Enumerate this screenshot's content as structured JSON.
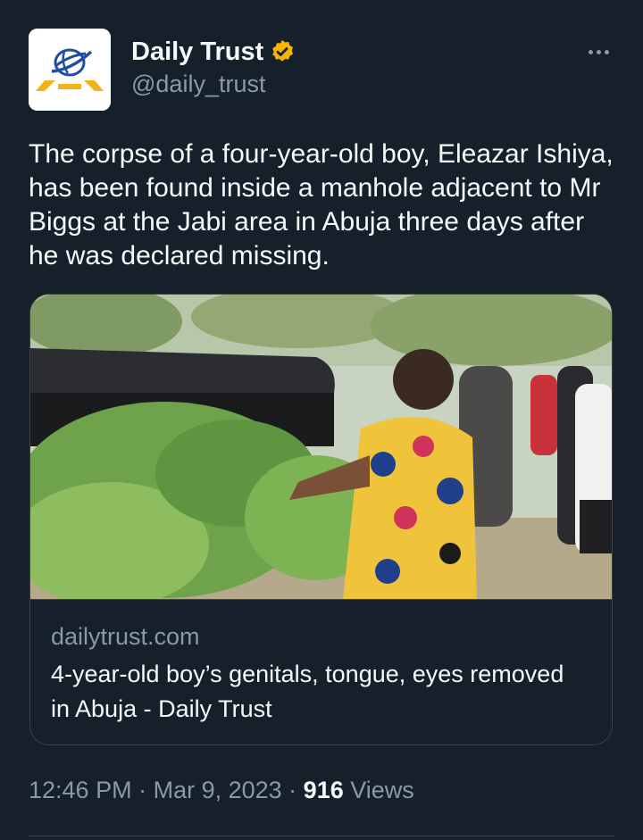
{
  "colors": {
    "background": "#15202b",
    "text_primary": "#f7f9f9",
    "text_secondary": "#8b98a5",
    "border": "#38444d",
    "verified_badge": "#f4b400",
    "logo_blue": "#1e4fa3",
    "logo_gold": "#f2b21a"
  },
  "author": {
    "avatar_icon": "daily-trust-logo-icon",
    "name": "Daily Trust",
    "verified_icon": "verified-badge-icon",
    "handle": "@daily_trust"
  },
  "header": {
    "more_icon": "more-options-icon"
  },
  "tweet": {
    "text": "The corpse of a four-year-old boy, Eleazar Ishiya, has been found inside a manhole adjacent to Mr Biggs at the Jabi area in Abuja three days after he was declared missing."
  },
  "card": {
    "image_icon": "article-photo",
    "domain": "dailytrust.com",
    "title": "4-year-old boy’s genitals, tongue, eyes removed in Abuja - Daily Trust"
  },
  "meta": {
    "time": "12:46 PM",
    "separator1": " · ",
    "date": "Mar 9, 2023",
    "separator2": " · ",
    "views_count": "916",
    "views_label": " Views"
  }
}
